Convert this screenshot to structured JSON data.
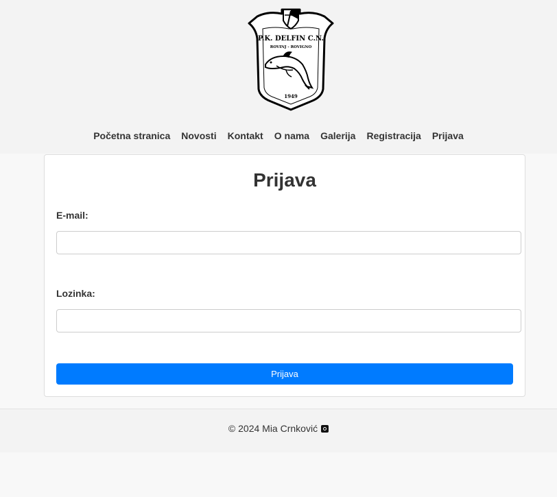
{
  "logo": {
    "club_name": "P.K. DELFIN C.N.",
    "city": "ROVINJ - ROVIGNO",
    "year": "1949"
  },
  "nav": {
    "items": [
      {
        "label": "Početna stranica"
      },
      {
        "label": "Novosti"
      },
      {
        "label": "Kontakt"
      },
      {
        "label": "O nama"
      },
      {
        "label": "Galerija"
      },
      {
        "label": "Registracija"
      },
      {
        "label": "Prijava"
      }
    ]
  },
  "login": {
    "title": "Prijava",
    "email_label": "E-mail:",
    "email_value": "",
    "password_label": "Lozinka:",
    "password_value": "",
    "submit_label": "Prijava"
  },
  "footer": {
    "copyright": "© 2024 Mia Crnković",
    "icon": "instagram-icon"
  },
  "colors": {
    "accent": "#007bff",
    "header_bg": "#f3f3f3",
    "page_bg": "#f8f8f8",
    "text": "#333333"
  }
}
